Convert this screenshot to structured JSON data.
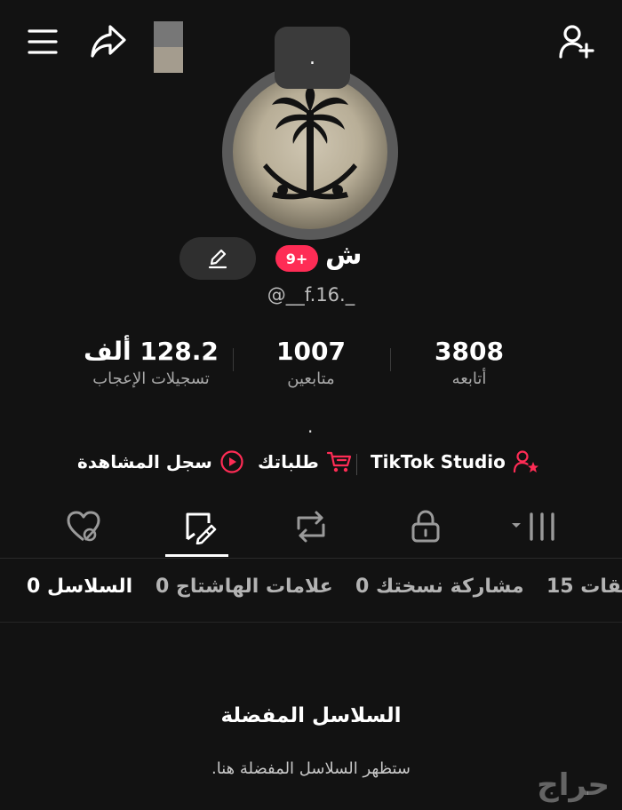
{
  "profile": {
    "display_name": "ش",
    "notification_badge": "9+",
    "username": "@__f.16._",
    "story_text": "."
  },
  "stats": {
    "following": {
      "value": "3808",
      "label": "أتابعه"
    },
    "followers": {
      "value": "1007",
      "label": "متابعين"
    },
    "likes": {
      "value": "128.2 ألف",
      "label": "تسجيلات الإعجاب"
    }
  },
  "bio_text": ".",
  "links": {
    "studio": "TikTok Studio",
    "orders": "طلباتك",
    "history": "سجل المشاهدة"
  },
  "tabs": [
    "videos-grid",
    "private",
    "reposts",
    "favorites",
    "liked"
  ],
  "active_tab": "favorites",
  "subtabs": [
    {
      "label": "السلاسل 0",
      "active": true
    },
    {
      "label": "علامات الهاشتاج 0",
      "active": false
    },
    {
      "label": "مشاركة نسختك 0",
      "active": false
    },
    {
      "label": "يقات 15",
      "active": false
    }
  ],
  "empty_state": {
    "title": "السلاسل المفضلة",
    "description": "ستظهر السلاسل المفضلة هنا."
  },
  "watermark": "حراج",
  "colors": {
    "background": "#121212",
    "accent": "#fe2c55",
    "secondary_text": "#a8a8a8"
  }
}
